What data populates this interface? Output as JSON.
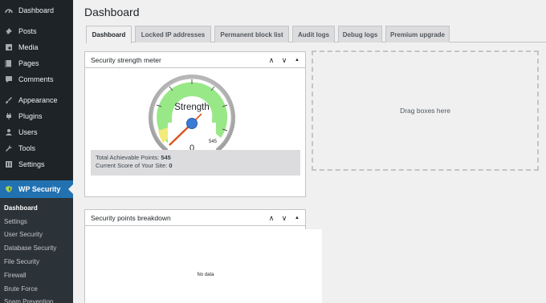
{
  "sidebar": {
    "items": [
      {
        "label": "Dashboard",
        "icon": "dashboard-icon"
      },
      {
        "label": "Posts",
        "icon": "pushpin-icon"
      },
      {
        "label": "Media",
        "icon": "media-icon"
      },
      {
        "label": "Pages",
        "icon": "pages-icon"
      },
      {
        "label": "Comments",
        "icon": "comments-icon"
      },
      {
        "label": "Appearance",
        "icon": "brush-icon"
      },
      {
        "label": "Plugins",
        "icon": "plugin-icon"
      },
      {
        "label": "Users",
        "icon": "users-icon"
      },
      {
        "label": "Tools",
        "icon": "wrench-icon"
      },
      {
        "label": "Settings",
        "icon": "settings-icon"
      },
      {
        "label": "WP Security",
        "icon": "shield-icon"
      }
    ],
    "submenu": [
      "Dashboard",
      "Settings",
      "User Security",
      "Database Security",
      "File Security",
      "Firewall",
      "Brute Force",
      "Spam Prevention"
    ]
  },
  "page": {
    "title": "Dashboard"
  },
  "tabs": [
    "Dashboard",
    "Locked IP addresses",
    "Permanent block list",
    "Audit logs",
    "Debug logs",
    "Premium upgrade"
  ],
  "strength_box": {
    "title": "Security strength meter",
    "gauge_label": "Strength",
    "current_value": "0",
    "max_value": "545",
    "total_label": "Total Achievable Points:",
    "total_value": "545",
    "score_label": "Current Score of Your Site:",
    "score_value": "0"
  },
  "dropzone": {
    "text": "Drag boxes here"
  },
  "breakdown_box": {
    "title": "Security points breakdown",
    "empty_text": "No data"
  },
  "controls": {
    "up": "∧",
    "down": "∨",
    "toggle": "▲"
  },
  "colors": {
    "sidebar_bg": "#1d2327",
    "accent": "#2271b1",
    "gauge_green": "#7ee787",
    "gauge_yellow": "#f5e663",
    "needle": "#e2622b",
    "hub": "#3a7bd5"
  }
}
